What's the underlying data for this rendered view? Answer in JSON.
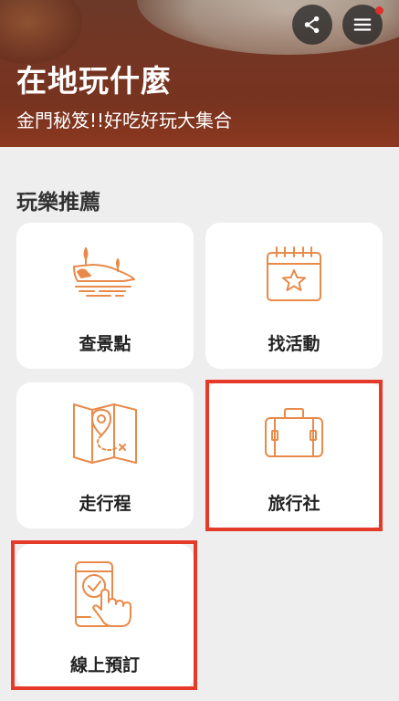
{
  "header": {
    "title": "在地玩什麼",
    "subtitle": "金門秘笈!!好吃好玩大集合",
    "share_icon": "share-icon",
    "menu_icon": "hamburger-menu-icon",
    "notification_color": "#e0302a"
  },
  "section": {
    "title": "玩樂推薦"
  },
  "cards": [
    {
      "label": "查景點",
      "icon": "landscape-icon"
    },
    {
      "label": "找活動",
      "icon": "calendar-star-icon"
    },
    {
      "label": "走行程",
      "icon": "map-route-icon"
    },
    {
      "label": "旅行社",
      "icon": "suitcase-icon"
    },
    {
      "label": "線上預訂",
      "icon": "phone-tap-icon"
    }
  ],
  "colors": {
    "accent": "#e88a4a",
    "highlight_border": "#e53a2a",
    "background": "#eeeeee"
  }
}
